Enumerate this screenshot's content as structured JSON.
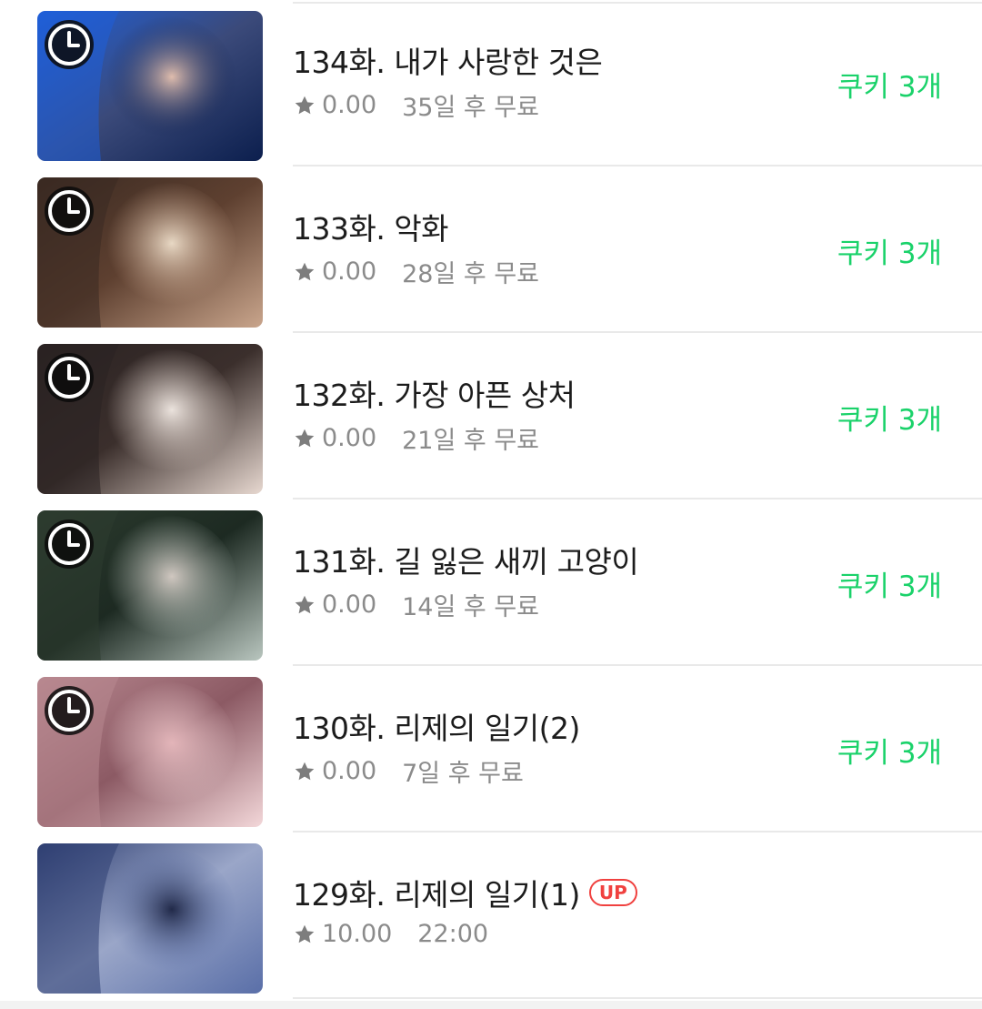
{
  "colors": {
    "price_green": "#1ad26a",
    "up_badge_red": "#f0413f",
    "meta_gray": "#8b8b8b",
    "title_text": "#1c1c1c"
  },
  "icons": {
    "wait_free": "clock-icon",
    "rating": "star-icon"
  },
  "episodes": [
    {
      "title": "134화. 내가 사랑한 것은",
      "rating": "0.00",
      "status": "35일 후 무료",
      "price": "쿠키 3개",
      "badge": "",
      "wait_free": true,
      "thumb_colors": [
        "#1f5fd8",
        "#0c1f4e",
        "#e8c3b0",
        "#3b4a7a"
      ]
    },
    {
      "title": "133화. 악화",
      "rating": "0.00",
      "status": "28일 후 무료",
      "price": "쿠키 3개",
      "badge": "",
      "wait_free": true,
      "thumb_colors": [
        "#3a2a22",
        "#c9a58c",
        "#efe0cc",
        "#5e4030"
      ]
    },
    {
      "title": "132화. 가장 아픈 상처",
      "rating": "0.00",
      "status": "21일 후 무료",
      "price": "쿠키 3개",
      "badge": "",
      "wait_free": true,
      "thumb_colors": [
        "#2a2222",
        "#e7d8d0",
        "#f4ece6",
        "#3b2f2c"
      ]
    },
    {
      "title": "131화. 길 잃은 새끼 고양이",
      "rating": "0.00",
      "status": "14일 후 무료",
      "price": "쿠키 3개",
      "badge": "",
      "wait_free": true,
      "thumb_colors": [
        "#2d3c2f",
        "#b9c6bf",
        "#d9cfc8",
        "#1d2a22"
      ]
    },
    {
      "title": "130화. 리제의 일기(2)",
      "rating": "0.00",
      "status": "7일 후 무료",
      "price": "쿠키 3개",
      "badge": "",
      "wait_free": true,
      "thumb_colors": [
        "#b88890",
        "#f3d7d9",
        "#e7b9bd",
        "#8c5a64"
      ]
    },
    {
      "title": "129화. 리제의 일기(1)",
      "rating": "10.00",
      "status": "22:00",
      "price": "",
      "badge": "UP",
      "wait_free": false,
      "thumb_colors": [
        "#2f3f72",
        "#5a6fa8",
        "#1b2342",
        "#9aa6c8"
      ]
    }
  ]
}
